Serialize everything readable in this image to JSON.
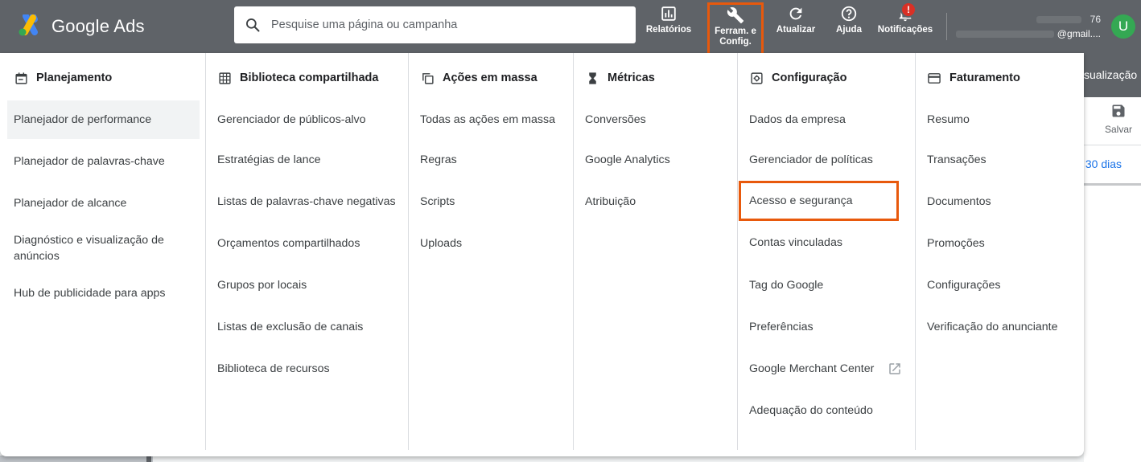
{
  "brand": {
    "name": "Google Ads"
  },
  "search": {
    "placeholder": "Pesquise uma página ou campanha"
  },
  "toolbar": {
    "reports": "Relatórios",
    "tools_line1": "Ferram. e",
    "tools_line2": "Config.",
    "refresh": "Atualizar",
    "help": "Ajuda",
    "notifications": "Notificações",
    "notifications_badge": "!"
  },
  "account": {
    "id_suffix": "76",
    "email_suffix": "@gmail....",
    "avatar_letter": "U"
  },
  "background": {
    "view_label": "sualização",
    "save_label": "Salvar",
    "date_range": "s 30 dias"
  },
  "menu": {
    "planning": {
      "title": "Planejamento",
      "items": [
        "Planejador de performance",
        "Planejador de palavras-chave",
        "Planejador de alcance",
        "Diagnóstico e visualização de anúncios",
        "Hub de publicidade para apps"
      ]
    },
    "shared_library": {
      "title": "Biblioteca compartilhada",
      "items": [
        "Gerenciador de públicos-alvo",
        "Estratégias de lance",
        "Listas de palavras-chave negativas",
        "Orçamentos compartilhados",
        "Grupos por locais",
        "Listas de exclusão de canais",
        "Biblioteca de recursos"
      ]
    },
    "bulk_actions": {
      "title": "Ações em massa",
      "items": [
        "Todas as ações em massa",
        "Regras",
        "Scripts",
        "Uploads"
      ]
    },
    "metrics": {
      "title": "Métricas",
      "items": [
        "Conversões",
        "Google Analytics",
        "Atribuição"
      ]
    },
    "setup": {
      "title": "Configuração",
      "items": [
        "Dados da empresa",
        "Gerenciador de políticas",
        "Acesso e segurança",
        "Contas vinculadas",
        "Tag do Google",
        "Preferências",
        "Google Merchant Center",
        "Adequação do conteúdo"
      ]
    },
    "billing": {
      "title": "Faturamento",
      "items": [
        "Resumo",
        "Transações",
        "Documentos",
        "Promoções",
        "Configurações",
        "Verificação do anunciante"
      ]
    }
  },
  "colors": {
    "topbar": "#5f6368",
    "highlight": "#e8590c",
    "badge": "#d93025",
    "avatar": "#34a853",
    "link": "#1a73e8"
  }
}
